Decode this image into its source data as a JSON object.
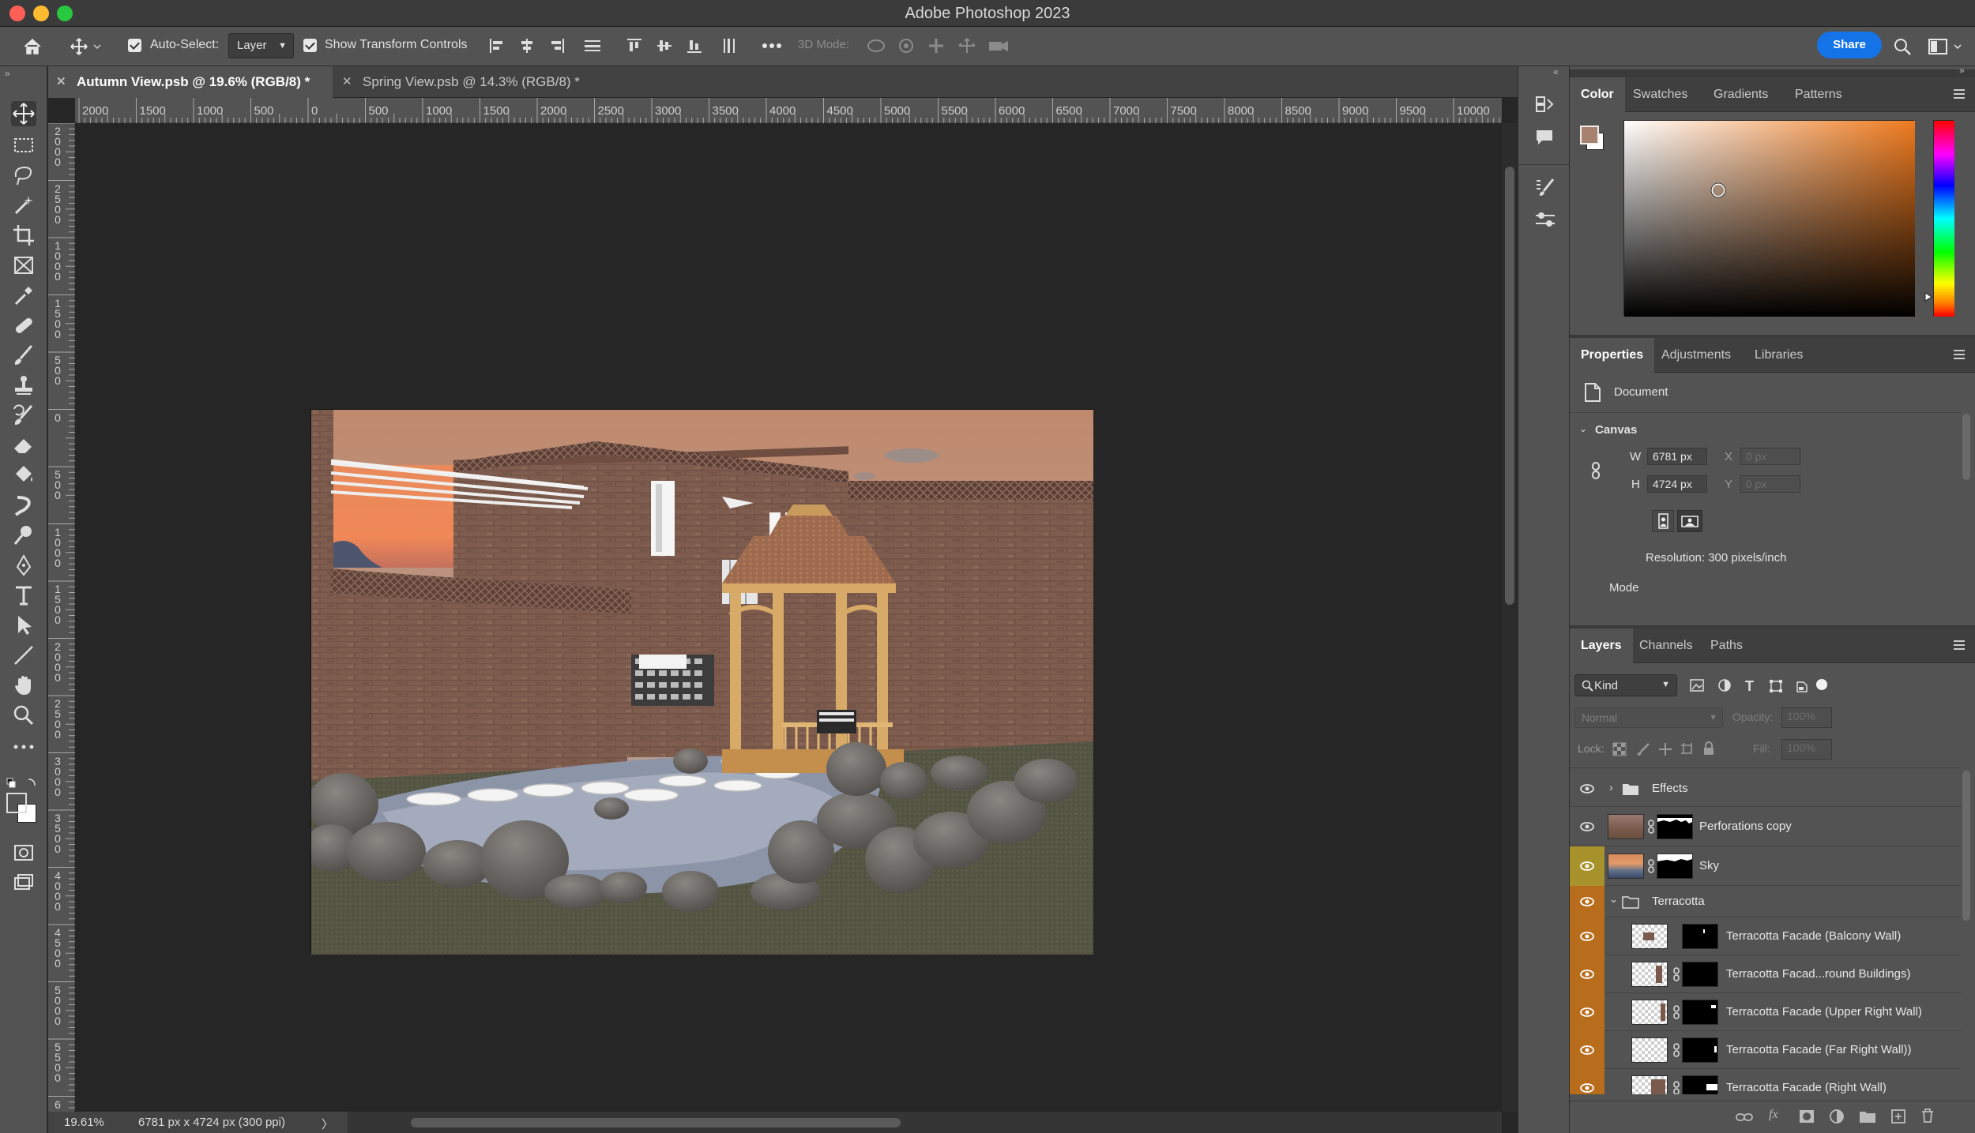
{
  "app": {
    "title": "Adobe Photoshop 2023"
  },
  "options_bar": {
    "auto_select_label": "Auto-Select:",
    "auto_select_value": "Layer",
    "show_transform_label": "Show Transform Controls",
    "mode_3d_label": "3D Mode:",
    "share_label": "Share"
  },
  "tabs": [
    {
      "label": "Autumn View.psb @ 19.6% (RGB/8) *",
      "active": true
    },
    {
      "label": "Spring View.psb @ 14.3% (RGB/8) *",
      "active": false
    }
  ],
  "ruler": {
    "h_labels": [
      "2000",
      "1500",
      "1000",
      "500",
      "0",
      "500",
      "1000",
      "1500",
      "2000",
      "2500",
      "3000",
      "3500",
      "4000",
      "4500",
      "5000",
      "5500",
      "6000",
      "6500",
      "7000",
      "7500",
      "8000",
      "8500",
      "9000",
      "9500",
      "10000"
    ],
    "v_labels": [
      "2000",
      "2500",
      "1000",
      "1500",
      "500",
      "0",
      "500",
      "1000",
      "1500",
      "2000",
      "2500",
      "3000",
      "3500",
      "4000",
      "4500",
      "5000",
      "5500",
      "6"
    ]
  },
  "status": {
    "zoom": "19.61%",
    "doc_info": "6781 px x 4724 px (300 ppi)",
    "arrow": "〉"
  },
  "color_panel": {
    "tabs": [
      "Color",
      "Swatches",
      "Gradients",
      "Patterns"
    ],
    "foreground": "#a88270",
    "background": "#ffffff",
    "hue_base": "#ee7a1e"
  },
  "properties_panel": {
    "tabs": [
      "Properties",
      "Adjustments",
      "Libraries"
    ],
    "type": "Document",
    "section": "Canvas",
    "w_label": "W",
    "w_value": "6781 px",
    "h_label": "H",
    "h_value": "4724 px",
    "x_label": "X",
    "x_value": "0 px",
    "y_label": "Y",
    "y_value": "0 px",
    "resolution": "Resolution: 300 pixels/inch",
    "mode_label": "Mode"
  },
  "layers_panel": {
    "tabs": [
      "Layers",
      "Channels",
      "Paths"
    ],
    "filter_kind": "Kind",
    "blend_mode": "Normal",
    "opacity_label": "Opacity:",
    "opacity_value": "100%",
    "lock_label": "Lock:",
    "fill_label": "Fill:",
    "fill_value": "100%",
    "layers": [
      {
        "name": "Effects",
        "type": "group",
        "collapsed": true
      },
      {
        "name": "Perforations copy",
        "type": "layer"
      },
      {
        "name": "Sky",
        "type": "layer"
      },
      {
        "name": "Terracotta",
        "type": "group",
        "collapsed": false
      },
      {
        "name": "Terracotta Facade (Balcony Wall)",
        "type": "layer"
      },
      {
        "name": "Terracotta Facad...round Buildings)",
        "type": "layer"
      },
      {
        "name": "Terracotta Facade (Upper Right Wall)",
        "type": "layer"
      },
      {
        "name": "Terracotta Facade (Far Right Wall))",
        "type": "layer"
      },
      {
        "name": "Terracotta Facade (Right Wall)",
        "type": "layer"
      }
    ]
  }
}
